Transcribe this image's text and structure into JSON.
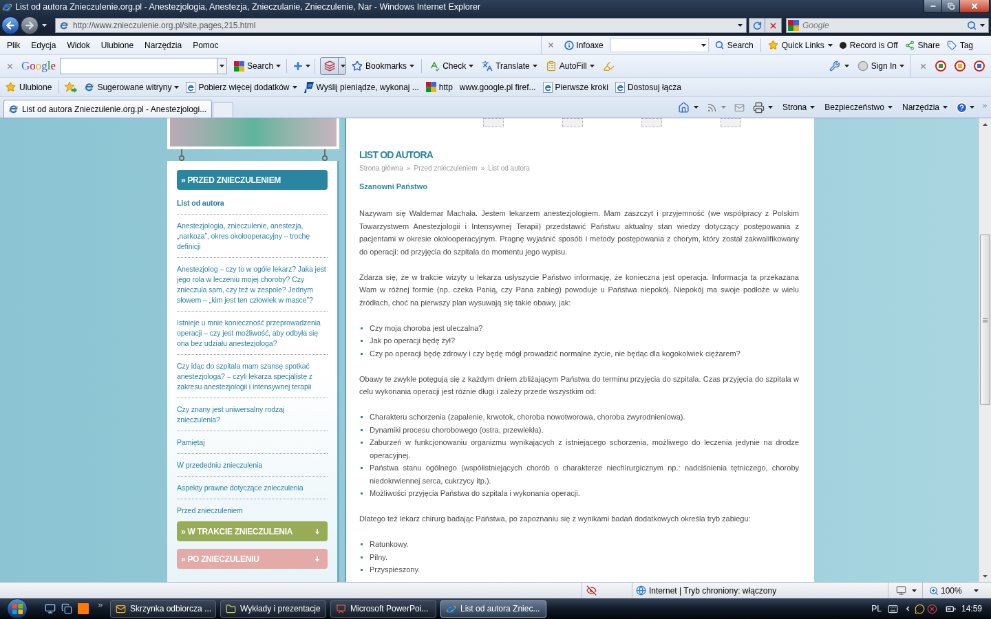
{
  "window": {
    "title": "List od autora Znieczulenie.org.pl - Anestezjologia, Anestezja, Znieczulanie, Znieczulenie, Nar - Windows Internet Explorer"
  },
  "address_bar": {
    "url": "http://www.znieczulenie.org.pl/site,pages,215.html",
    "search": {
      "placeholder": "Google"
    }
  },
  "menu_bar": [
    "Plik",
    "Edycja",
    "Widok",
    "Ulubione",
    "Narzędzia",
    "Pomoc"
  ],
  "infoaxe_toolbar": {
    "name": "Infoaxe",
    "search_button": "Search",
    "buttons": [
      {
        "kind": "quick_links",
        "label": "Quick Links",
        "dropdown": true
      },
      {
        "kind": "record",
        "label": "Record is Off",
        "dropdown": false
      },
      {
        "kind": "share",
        "label": "Share",
        "dropdown": false
      },
      {
        "kind": "tag",
        "label": "Tag",
        "dropdown": false
      }
    ]
  },
  "google_toolbar": {
    "logo": "Google",
    "buttons": [
      {
        "kind": "search",
        "label": "Search",
        "dropdown": true
      },
      {
        "kind": "bookmarks",
        "label": "Bookmarks",
        "dropdown": true
      },
      {
        "kind": "check",
        "label": "Check",
        "dropdown": true
      },
      {
        "kind": "translate",
        "label": "Translate",
        "dropdown": true
      },
      {
        "kind": "autofill",
        "label": "AutoFill",
        "dropdown": true
      }
    ],
    "sign_in": "Sign In"
  },
  "favorites_bar": {
    "label": "Ulubione",
    "links": [
      {
        "kind": "ie",
        "label": "Sugerowane witryny",
        "dropdown": true
      },
      {
        "kind": "ie_page",
        "label": "Pobierz więcej dodatków",
        "dropdown": true
      },
      {
        "kind": "paypal",
        "label": "Wyślij pieniądze, wykonaj ...",
        "dropdown": false
      },
      {
        "kind": "google",
        "label": "http",
        "dropdown": false
      },
      {
        "kind": "none",
        "label": "www.google.pl firef...",
        "dropdown": false
      },
      {
        "kind": "ie_page",
        "label": "Pierwsze kroki",
        "dropdown": false
      },
      {
        "kind": "ie_page",
        "label": "Dostosuj łącza",
        "dropdown": false
      }
    ]
  },
  "tabs": [
    {
      "label": "List od autora Znieczulenie.org.pl - Anestezjologi...",
      "selected": true
    }
  ],
  "command_bar": [
    "Strona",
    "Bezpieczeństwo",
    "Narzędzia"
  ],
  "page": {
    "sidebar": {
      "sections": [
        {
          "title": "» PRZED ZNIECZULENIEM",
          "color": "#2a86a0",
          "expanded": true,
          "items": [
            {
              "label": "List od autora",
              "selected": true
            },
            {
              "label": "Anestezjologia, znieczulenie, anestezja, „narkoza”, okres okołooperacyjny – trochę definicji",
              "selected": false
            },
            {
              "label": "Anestezjolog – czy to w ogóle lekarz? Jaka jest jego rola w leczeniu mojej choroby? Czy znieczula sam, czy też w zespole? Jednym słowem – „kim jest ten człowiek w masce”?",
              "selected": false
            },
            {
              "label": "Istnieje u mnie konieczność przeprowadzenia operacji – czy jest możliwość, aby odbyła się ona bez udziału anestezjologa?",
              "selected": false
            },
            {
              "label": "Czy idąc do szpitala mam szansę spotkać anestezjologa? – czyli lekarza specjalistę z zakresu anestezjologii i intensywnej terapii",
              "selected": false
            },
            {
              "label": "Czy znany jest uniwersalny rodzaj znieczulenia?",
              "selected": false
            },
            {
              "label": "Pamiętaj",
              "selected": false
            },
            {
              "label": "W przededniu znieczulenia",
              "selected": false
            },
            {
              "label": "Aspekty prawne dotyczące znieczulenia",
              "selected": false
            },
            {
              "label": "Przed znieczuleniem",
              "selected": false
            }
          ]
        },
        {
          "title": "» W TRAKCIE ZNIECZULENIA",
          "color": "#98ab57",
          "expanded": false
        },
        {
          "title": "» PO ZNIECZULENIU",
          "color": "#e3aaa7",
          "expanded": false
        }
      ]
    },
    "article": {
      "title": "LIST OD AUTORA",
      "breadcrumb": [
        "Strona główna",
        "»",
        "Przed znieczuleniem",
        "»",
        "List od autora"
      ],
      "greeting": "Szanowni Państwo",
      "blocks": [
        {
          "kind": "paragraph",
          "text": "Nazywam się Waldemar Machała. Jestem lekarzem anestezjologiem. Mam zaszczyt i przyjemność (we współpracy z Polskim Towarzystwem Anestezjologii i Intensywnej Terapii) przedstawić Państwu aktualny stan wiedzy dotyczący postępowania z pacjentami w okresie okołooperacyjnym. Pragnę wyjaśnić sposób i metody postępowania z chorym, który został zakwalifikowany do operacji: od przyjęcia do szpitala do momentu jego wypisu."
        },
        {
          "kind": "paragraph",
          "text": "Zdarza się, że w trakcie wizyty u lekarza usłyszycie Państwo informację, że konieczna jest operacja. Informacja ta przekazana Wam w różnej formie (np. czeka Panią, czy Pana zabieg) powoduje u Państwa niepokój. Niepokój ma swoje podłoże w wielu źródłach, choć na pierwszy plan wysuwają się takie obawy, jak:"
        },
        {
          "kind": "list",
          "items": [
            "Czy moja choroba jest uleczalna?",
            "Jak po operacji będę żył?",
            "Czy po operacji będę zdrowy i czy będę mógł prowadzić normalne życie, nie będąc dla kogokolwiek ciężarem?"
          ]
        },
        {
          "kind": "paragraph",
          "text": "Obawy te zwykle potęgują się z każdym dniem zbliżającym Państwa do terminu przyjęcia do szpitala. Czas przyjęcia do szpitala w celu wykonania operacji jest różnie długi i zależy przede wszystkim od:"
        },
        {
          "kind": "list",
          "items": [
            "Charakteru schorzenia (zapalenie, krwotok, choroba nowotworowa, choroba zwyrodnieniowa).",
            "Dynamiki procesu chorobowego (ostra, przewlekła).",
            "Zaburzeń w funkcjonowaniu organizmu wynikających z istniejącego schorzenia, możliwego do leczenia jedynie na drodze operacyjnej.",
            "Państwa stanu ogólnego (współistniejących chorób o charakterze niechirurgicznym np.: nadciśnienia tętniczego, choroby niedokrwiennej serca, cukrzycy itp.).",
            "Możliwości przyjęcia Państwa do szpitala i wykonania operacji."
          ]
        },
        {
          "kind": "paragraph",
          "text": "Dlatego też lekarz chirurg badając Państwa, po zapoznaniu się z wynikami badań dodatkowych określa tryb zabiegu:"
        },
        {
          "kind": "list",
          "items": [
            "Ratunkowy.",
            "Pilny.",
            "Przyspieszony."
          ]
        }
      ]
    }
  },
  "status_bar": {
    "zone": "Internet | Tryb chroniony: włączony",
    "zoom": "100%"
  },
  "taskbar": {
    "buttons": [
      {
        "kind": "mail",
        "label": "Skrzynka odbiorcza ...",
        "selected": false
      },
      {
        "kind": "folder",
        "label": "Wykłady i prezentacje",
        "selected": false
      },
      {
        "kind": "powerpoint",
        "label": "Microsoft PowerPoi...",
        "selected": false
      },
      {
        "kind": "ie",
        "label": "List od autora Zniec...",
        "selected": true
      }
    ],
    "language": "PL",
    "clock": "14:59"
  }
}
